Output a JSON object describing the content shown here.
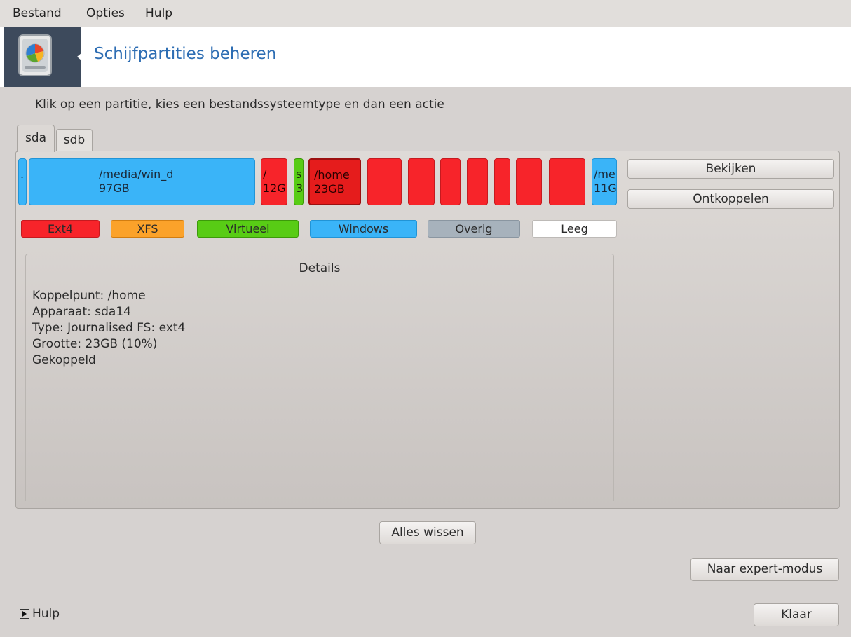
{
  "menu": {
    "file": {
      "first": "B",
      "rest": "estand"
    },
    "options": {
      "first": "O",
      "rest": "pties"
    },
    "help": {
      "first": "H",
      "rest": "ulp"
    }
  },
  "banner": {
    "title": "Schijfpartities beheren",
    "icon": "harddisk-icon"
  },
  "instruction": "Klik op een partitie, kies een bestandssysteemtype en dan een actie",
  "tabs": [
    "sda",
    "sdb"
  ],
  "partitions": [
    {
      "line1": ".",
      "line2": "",
      "type": "Windows"
    },
    {
      "line1": "/media/win_d",
      "line2": "97GB",
      "type": "Windows"
    },
    {
      "line1": "/",
      "line2": "12G",
      "type": "Ext4"
    },
    {
      "line1": "s",
      "line2": "3",
      "type": "Virtueel"
    },
    {
      "line1": "/home",
      "line2": "23GB",
      "type": "Ext4",
      "selected": true
    },
    {
      "line1": "",
      "line2": "",
      "type": "Ext4"
    },
    {
      "line1": "",
      "line2": "",
      "type": "Ext4"
    },
    {
      "line1": "",
      "line2": "",
      "type": "Ext4"
    },
    {
      "line1": "",
      "line2": "",
      "type": "Ext4"
    },
    {
      "line1": "",
      "line2": "",
      "type": "Ext4"
    },
    {
      "line1": "",
      "line2": "",
      "type": "Ext4"
    },
    {
      "line1": "",
      "line2": "",
      "type": "Ext4"
    },
    {
      "line1": "/me",
      "line2": "11G",
      "type": "Windows"
    }
  ],
  "legend": [
    {
      "label": "Ext4",
      "color": "#f7242a"
    },
    {
      "label": "XFS",
      "color": "#fba22a"
    },
    {
      "label": "Virtueel",
      "color": "#58cc15"
    },
    {
      "label": "Windows",
      "color": "#3ab4f8"
    },
    {
      "label": "Overig",
      "color": "#a7b2bc"
    },
    {
      "label": "Leeg",
      "color": "#ffffff"
    }
  ],
  "actions": {
    "view": "Bekijken",
    "unmount": "Ontkoppelen"
  },
  "details": {
    "title": "Details",
    "lines": [
      "Koppelpunt: /home",
      "Apparaat: sda14",
      "Type: Journalised FS: ext4",
      "Grootte: 23GB (10%)",
      "Gekoppeld"
    ]
  },
  "buttons": {
    "clear_all": "Alles wissen",
    "expert": "Naar expert-modus",
    "done": "Klaar"
  },
  "help": "Hulp"
}
